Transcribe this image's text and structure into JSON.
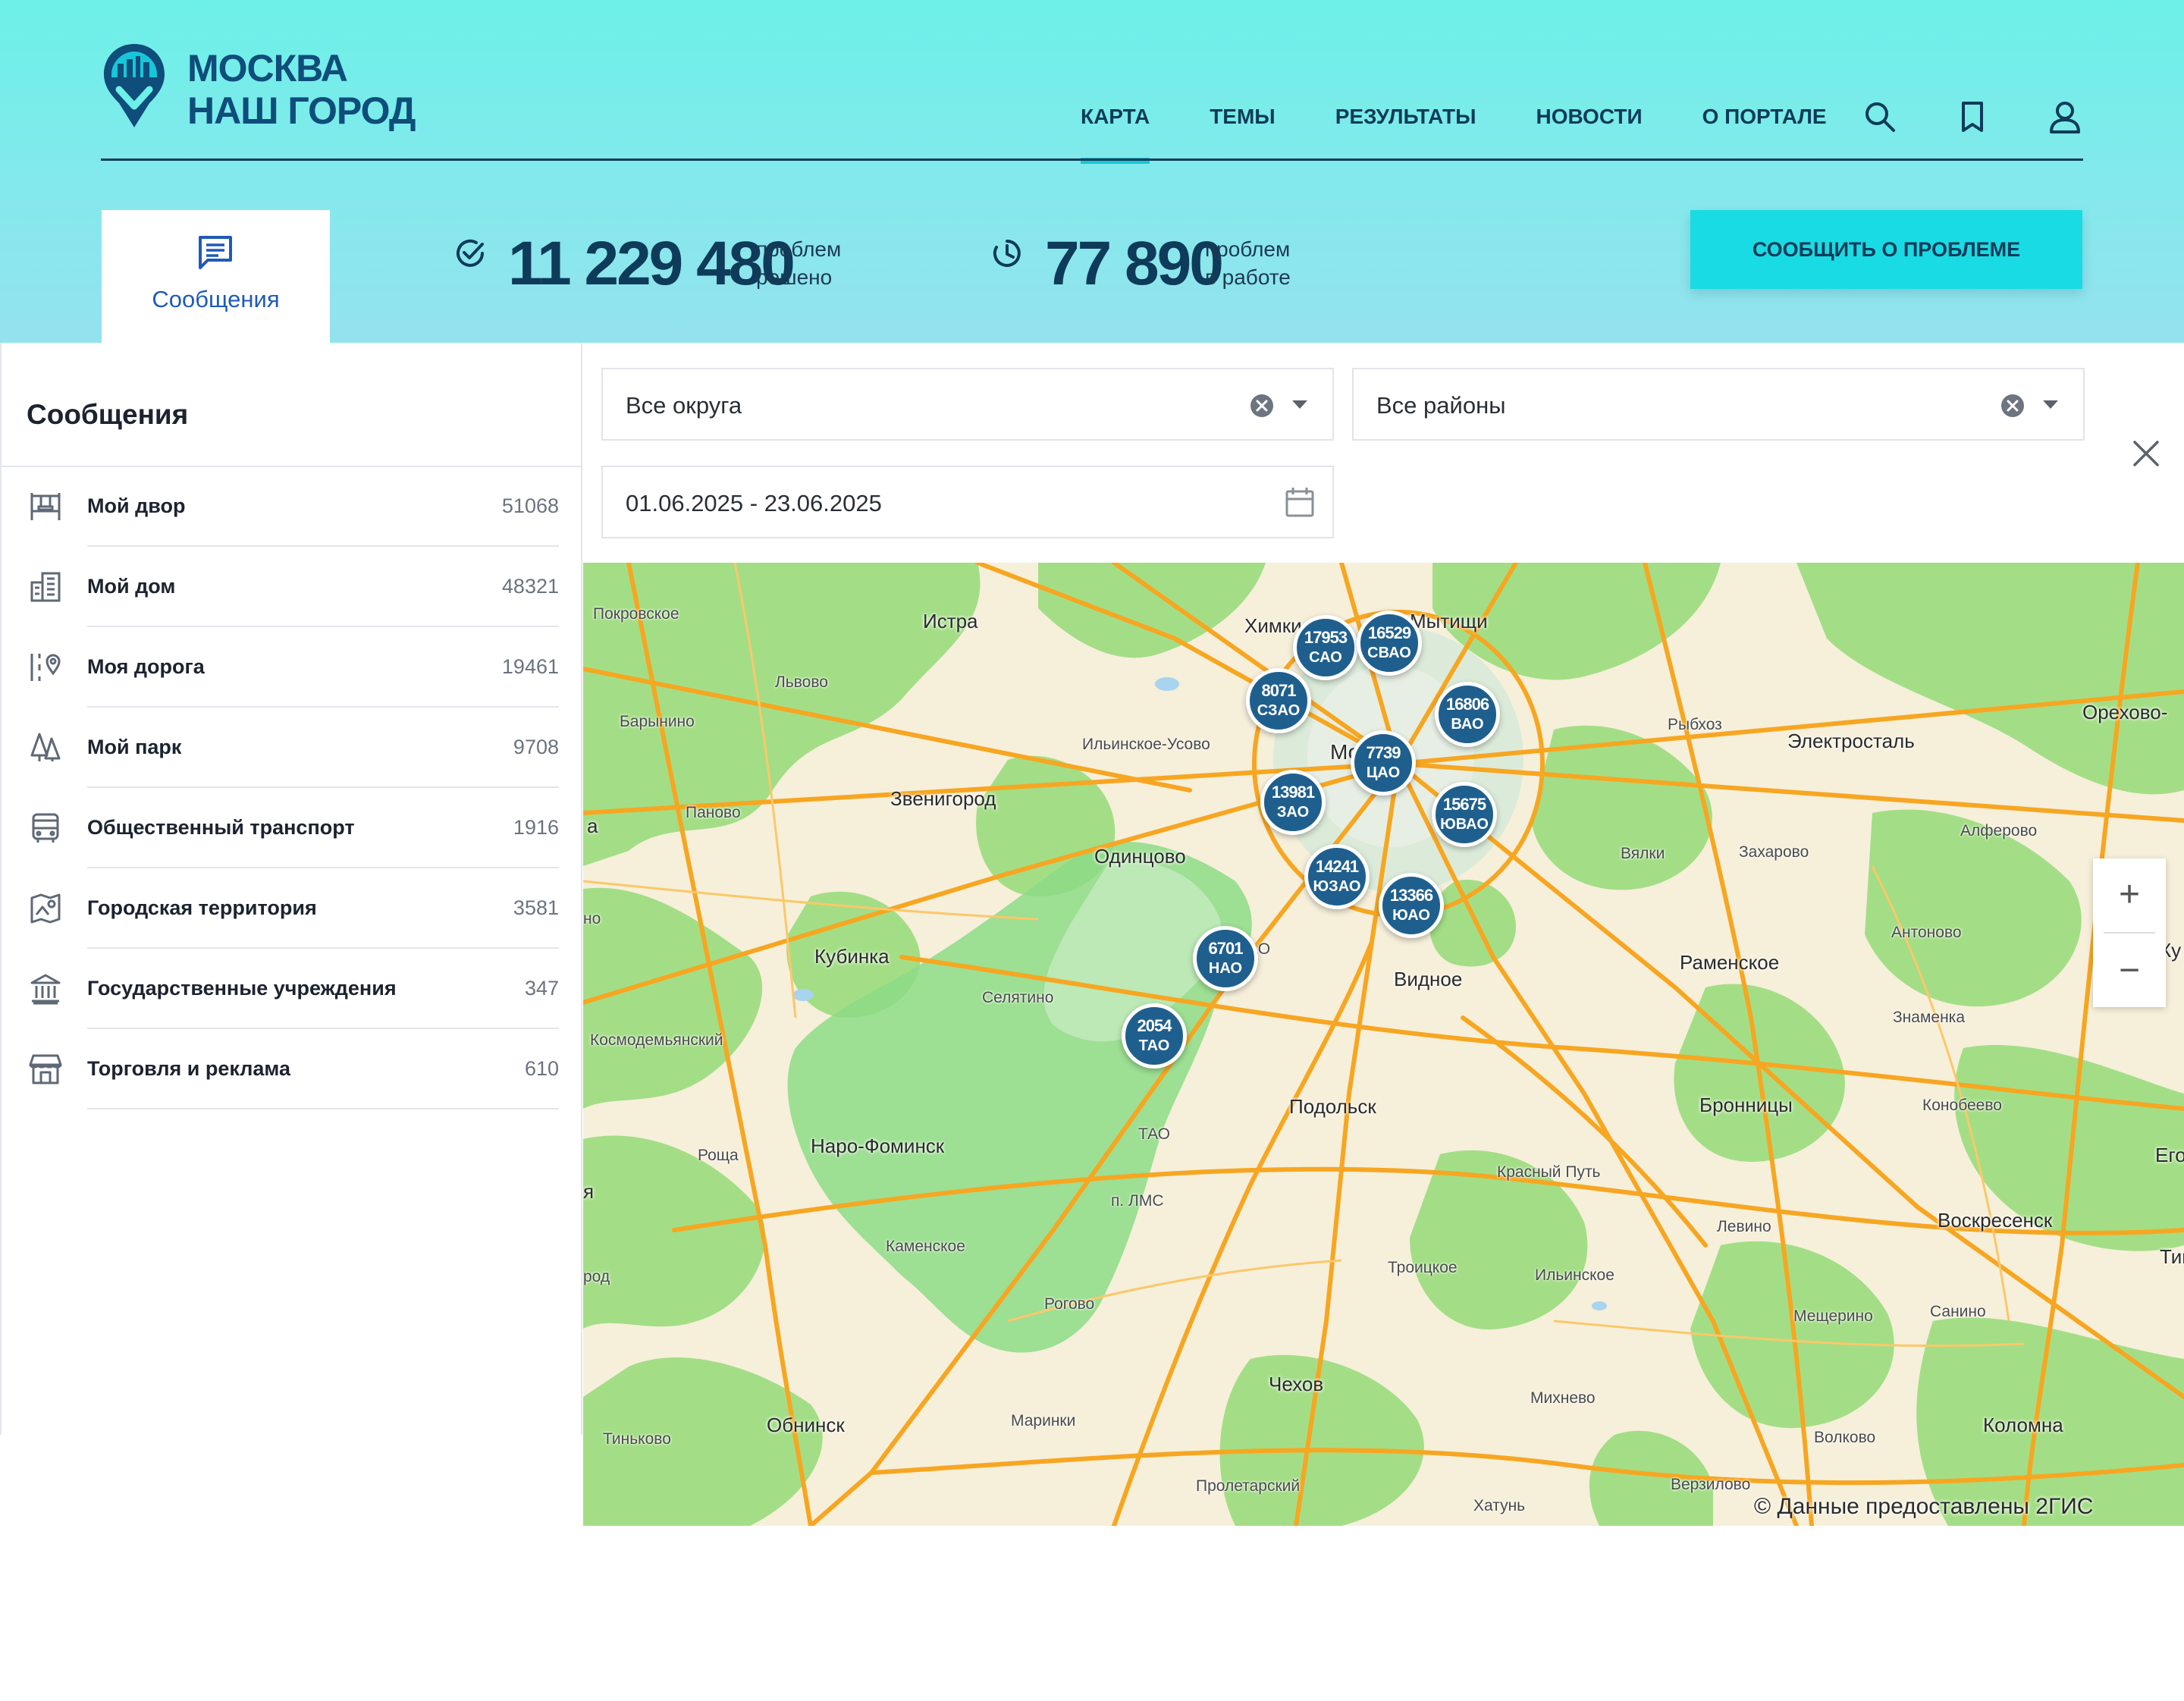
{
  "header": {
    "logo": {
      "line1": "МОСКВА",
      "line2": "НАШ ГОРОД"
    },
    "nav": [
      "КАРТА",
      "ТЕМЫ",
      "РЕЗУЛЬТАТЫ",
      "НОВОСТИ",
      "О ПОРТАЛЕ"
    ],
    "active_nav": "КАРТА",
    "icons": [
      "search-icon",
      "bookmark-icon",
      "user-icon"
    ]
  },
  "tab": {
    "label": "Сообщения",
    "icon": "message-icon"
  },
  "stats": {
    "solved": {
      "value": "11 229 480",
      "label1": "проблем",
      "label2": "решено",
      "icon": "check-circle-icon"
    },
    "in_work": {
      "value": "77 890",
      "label1": "проблем",
      "label2": "в работе",
      "icon": "clock-icon"
    }
  },
  "report_button": "СООБЩИТЬ О ПРОБЛЕМЕ",
  "sidebar": {
    "title": "Сообщения",
    "items": [
      {
        "label": "Мой двор",
        "count": "51068",
        "icon": "yard-icon"
      },
      {
        "label": "Мой дом",
        "count": "48321",
        "icon": "building-icon"
      },
      {
        "label": "Моя дорога",
        "count": "19461",
        "icon": "road-icon"
      },
      {
        "label": "Мой парк",
        "count": "9708",
        "icon": "park-icon"
      },
      {
        "label": "Общественный транспорт",
        "count": "1916",
        "icon": "bus-icon"
      },
      {
        "label": "Городская территория",
        "count": "3581",
        "icon": "territory-icon"
      },
      {
        "label": "Государственные учреждения",
        "count": "347",
        "icon": "institution-icon"
      },
      {
        "label": "Торговля и реклама",
        "count": "610",
        "icon": "store-icon"
      }
    ]
  },
  "filters": {
    "okrug": "Все округа",
    "rayon": "Все районы",
    "dates": "01.06.2025 - 23.06.2025"
  },
  "map": {
    "clusters": [
      {
        "count": "17953",
        "district": "САО"
      },
      {
        "count": "16529",
        "district": "СВАО"
      },
      {
        "count": "8071",
        "district": "СЗАО"
      },
      {
        "count": "16806",
        "district": "ВАО"
      },
      {
        "count": "7739",
        "district": "ЦАО"
      },
      {
        "count": "13981",
        "district": "ЗАО"
      },
      {
        "count": "15675",
        "district": "ЮВАО"
      },
      {
        "count": "14241",
        "district": "ЮЗАО"
      },
      {
        "count": "13366",
        "district": "ЮАО"
      },
      {
        "count": "6701",
        "district": "НАО"
      },
      {
        "count": "2054",
        "district": "ТАО"
      }
    ],
    "places": {
      "istra": "Истра",
      "khimki": "Химки",
      "mytishchi": "Мытищи",
      "pokrovskoe": "Покровское",
      "lvovo": "Львово",
      "barynino": "Барынино",
      "rybkhoz": "Рыбхоз",
      "elektrostal": "Электросталь",
      "orekhovo": "Орехово-",
      "ilinskoe_usovo": "Ильинское-Усово",
      "moskva": "Москва",
      "zvenigorod": "Звенигород",
      "panovo": "Паново",
      "odintsovo": "Одинцово",
      "vyalki": "Вялки",
      "zakharovo": "Захарово",
      "alferovo": "Алферово",
      "antonovo": "Антоново",
      "kubinka": "Кубинка",
      "selyatino": "Селятино",
      "ramenskoe": "Раменское",
      "vidnoe": "Видное",
      "kosmodemyansky": "Космодемьянский",
      "znamenka": "Знаменка",
      "podolsk": "Подольск",
      "bronnitsy": "Бронницы",
      "konobeevo": "Конобеево",
      "naro_fominsk": "Наро-Фоминск",
      "tao": "ТАО",
      "rosha": "Роща",
      "krasny_put": "Красный Путь",
      "egor": "Егор",
      "p_lms": "п. ЛМС",
      "levino": "Левино",
      "voskresensk": "Воскресенск",
      "kamenskoe": "Каменское",
      "troitskoe": "Троицкое",
      "ilinskoe": "Ильинское",
      "timsh": "Тимш",
      "rogovo": "Рогово",
      "meshcherino": "Мещерино",
      "sanino": "Санино",
      "chekhov": "Чехов",
      "mikhnevo": "Михнево",
      "obninsk": "Обнинск",
      "marinki": "Маринки",
      "volkovo": "Волково",
      "kolomna": "Коломна",
      "tinyakovo": "Тиньково",
      "proletarsky": "Пролетарский",
      "khatun": "Хатунь",
      "verzilovo": "Верзилово",
      "nao": "НАО",
      "no": "но",
      "a": "а",
      "ya": "я",
      "rod": "род",
      "ku": "Ку"
    },
    "attribution": "© Данные предоставлены 2ГИС",
    "zoom_in": "+",
    "zoom_out": "−",
    "colors": {
      "forest": "#a3de86",
      "land": "#f6efda",
      "road": "#f7a621",
      "new_moscow": "#8ddc86",
      "cluster": "#1f5f8e"
    }
  }
}
